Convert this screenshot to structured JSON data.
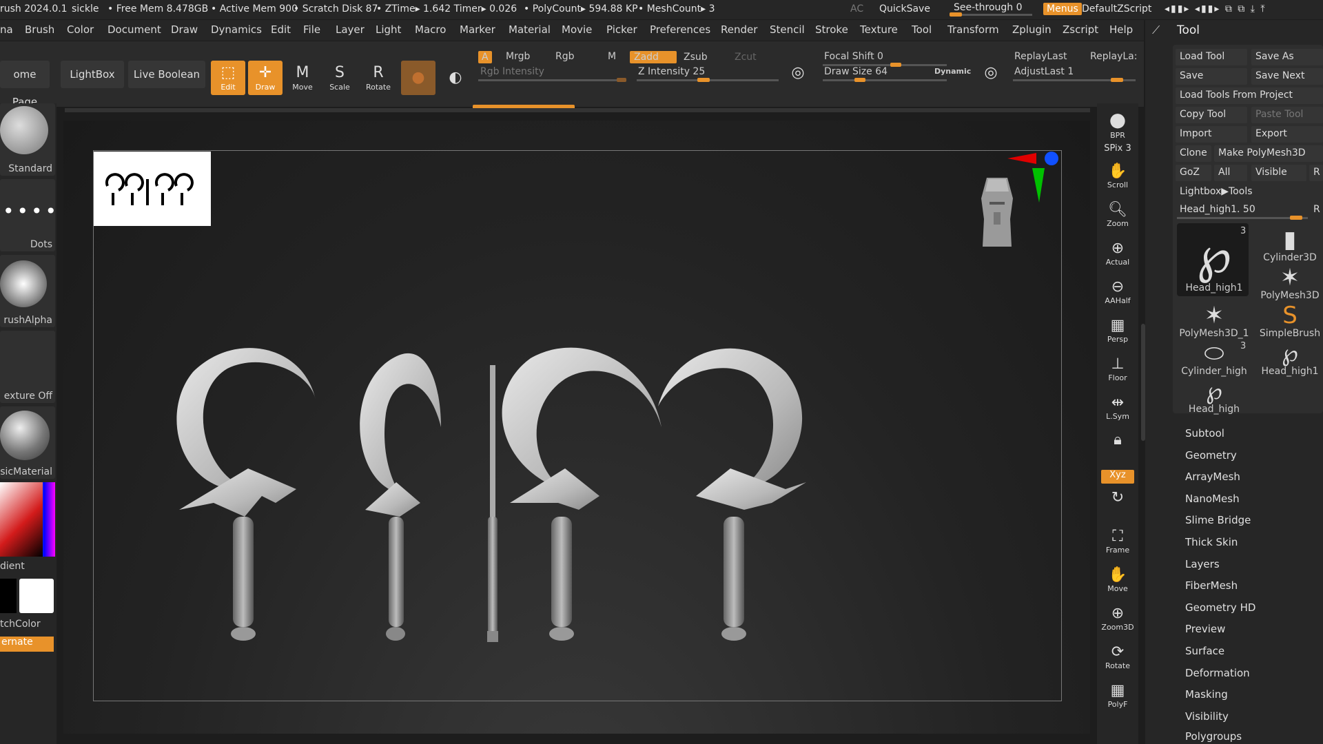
{
  "titlebar": {
    "app": "rush 2024.0.1",
    "file": "sickle",
    "free_mem": "Free Mem 8.478GB",
    "active_mem": "Active Mem 900",
    "scratch": "Scratch Disk 87",
    "ztime": "ZTime▸ 1.642 Timer▸ 0.026",
    "polycount": "PolyCount▸ 594.88 KP",
    "meshcount": "MeshCount▸ 3",
    "ac": "AC",
    "quicksave": "QuickSave",
    "seethrough": "See-through  0",
    "menus": "Menus",
    "script": "DefaultZScript"
  },
  "menubar": [
    "na",
    "Brush",
    "Color",
    "Document",
    "Draw",
    "Dynamics",
    "Edit",
    "File",
    "Layer",
    "Light",
    "Macro",
    "Marker",
    "Material",
    "Movie",
    "Picker",
    "Preferences",
    "Render",
    "Stencil",
    "Stroke",
    "Texture",
    "Tool",
    "Transform",
    "Zplugin",
    "Zscript",
    "Help"
  ],
  "toolbar": {
    "home": "ome Page",
    "lightbox": "LightBox",
    "live_boolean": "Live Boolean",
    "edit": "Edit",
    "draw": "Draw",
    "move": "Move",
    "scale": "Scale",
    "rotate": "Rotate",
    "a": "A",
    "mrgb": "Mrgb",
    "rgb": "Rgb",
    "m": "M",
    "zadd": "Zadd",
    "zsub": "Zsub",
    "zcut": "Zcut",
    "rgb_intensity": "Rgb Intensity",
    "z_intensity": "Z Intensity 25",
    "focal_shift": "Focal Shift 0",
    "draw_size": "Draw Size 64",
    "dynamic": "Dynamic",
    "replaylast": "ReplayLast",
    "replaylast2": "ReplayLa:",
    "adjustlast": "AdjustLast 1"
  },
  "leftpanel": {
    "standard": "Standard",
    "dots": "Dots",
    "brushalpha": "rushAlpha",
    "texture": "exture Off",
    "material": "sicMaterial",
    "gradient": "dient",
    "switchcolor": "tchColor",
    "alternate": "ernate"
  },
  "shelf": [
    "BPR",
    "SPix 3",
    "Scroll",
    "Zoom",
    "Actual",
    "AAHalf",
    "Persp",
    "Floor",
    "L.Sym",
    "",
    "Xyz",
    "",
    "",
    "Frame",
    "Move",
    "Zoom3D",
    "Rotate",
    "PolyF"
  ],
  "toolpalette": {
    "title": "Tool",
    "load_tool": "Load Tool",
    "save_as": "Save As",
    "save": "Save",
    "save_next": "Save Next",
    "load_from_project": "Load Tools From Project",
    "copy_tool": "Copy Tool",
    "paste_tool": "Paste Tool",
    "import": "Import",
    "export": "Export",
    "clone": "Clone",
    "make_polymesh": "Make PolyMesh3D",
    "goz": "GoZ",
    "all": "All",
    "visible": "Visible",
    "r": "R",
    "lightbox_tools": "Lightbox▶Tools",
    "head_slider": "Head_high1. 50",
    "thumbs": [
      {
        "name": "Head_high1",
        "count": "3"
      },
      {
        "name": "Cylinder3D",
        "count": ""
      },
      {
        "name": "PolyMesh3D",
        "count": ""
      },
      {
        "name": "PolyMesh3D_1",
        "count": ""
      },
      {
        "name": "SimpleBrush",
        "count": ""
      },
      {
        "name": "Cylinder_high",
        "count": "3"
      },
      {
        "name": "Head_high1",
        "count": ""
      },
      {
        "name": "Head_high",
        "count": ""
      }
    ],
    "subpalettes": [
      "Subtool",
      "Geometry",
      "ArrayMesh",
      "NanoMesh",
      "Slime Bridge",
      "Thick Skin",
      "Layers",
      "FiberMesh",
      "Geometry HD",
      "Preview",
      "Surface",
      "Deformation",
      "Masking",
      "Visibility",
      "Polygroups"
    ]
  },
  "colors": {
    "accent": "#e8922a",
    "bg": "#262626"
  }
}
